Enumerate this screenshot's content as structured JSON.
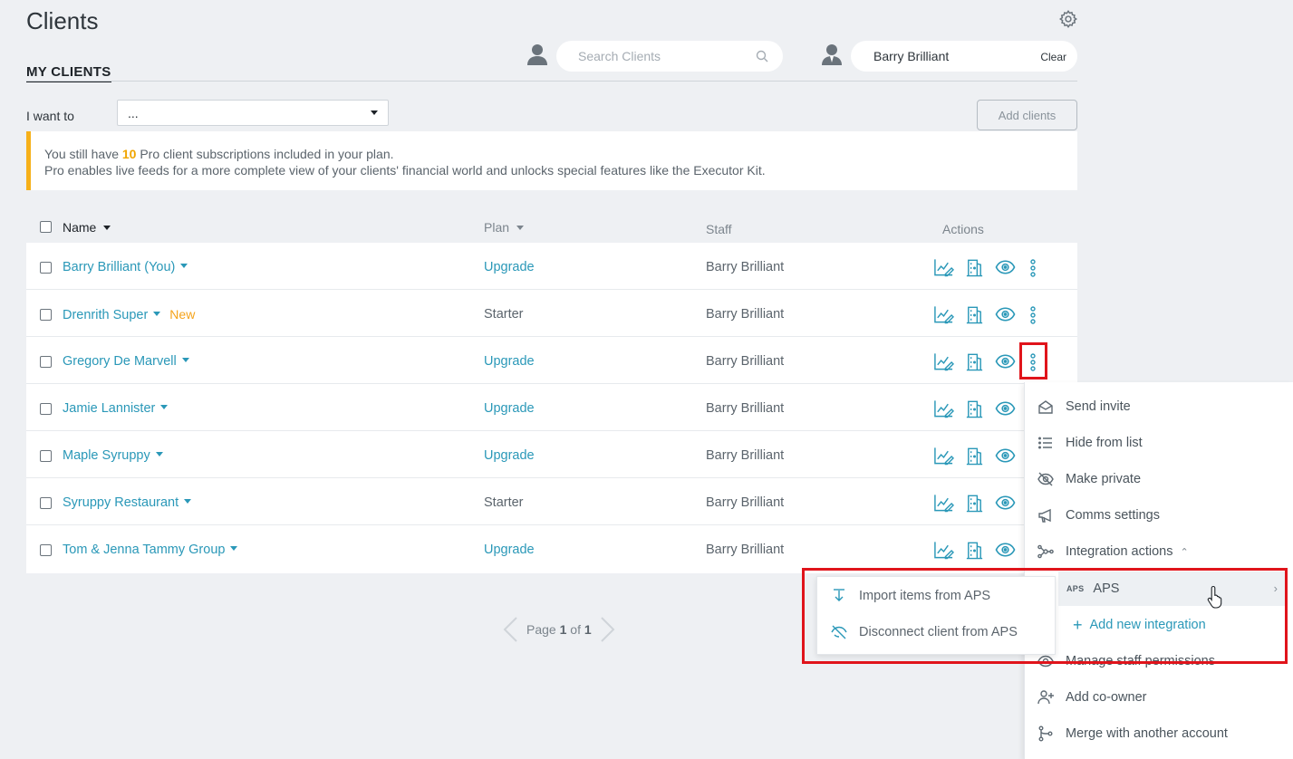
{
  "page": {
    "title": "Clients",
    "tab_label": "MY CLIENTS"
  },
  "search": {
    "placeholder": "Search Clients"
  },
  "staff_filter": {
    "value": "Barry Brilliant",
    "clear_label": "Clear"
  },
  "toolbar": {
    "i_want_to_label": "I want to",
    "i_want_to_value": "...",
    "add_clients_label": "Add clients"
  },
  "notice": {
    "line1_prefix": "You still have ",
    "line1_count": "10",
    "line1_suffix": " Pro client subscriptions included in your plan.",
    "line2": "Pro enables live feeds for a more complete view of your clients' financial world and unlocks special features like the Executor Kit."
  },
  "table": {
    "headers": {
      "name": "Name",
      "plan": "Plan",
      "staff": "Staff",
      "actions": "Actions"
    },
    "rows": [
      {
        "name": "Barry Brilliant (You)",
        "badge": "",
        "plan": "Upgrade",
        "plan_is_link": true,
        "staff": "Barry Brilliant"
      },
      {
        "name": "Drenrith Super",
        "badge": "New",
        "plan": "Starter",
        "plan_is_link": false,
        "staff": "Barry Brilliant"
      },
      {
        "name": "Gregory De Marvell",
        "badge": "",
        "plan": "Upgrade",
        "plan_is_link": true,
        "staff": "Barry Brilliant"
      },
      {
        "name": "Jamie Lannister",
        "badge": "",
        "plan": "Upgrade",
        "plan_is_link": true,
        "staff": "Barry Brilliant"
      },
      {
        "name": "Maple Syruppy",
        "badge": "",
        "plan": "Upgrade",
        "plan_is_link": true,
        "staff": "Barry Brilliant"
      },
      {
        "name": "Syruppy Restaurant",
        "badge": "",
        "plan": "Starter",
        "plan_is_link": false,
        "staff": "Barry Brilliant"
      },
      {
        "name": "Tom & Jenna Tammy Group",
        "badge": "",
        "plan": "Upgrade",
        "plan_is_link": true,
        "staff": "Barry Brilliant"
      }
    ]
  },
  "pagination": {
    "prefix": "Page ",
    "current": "1",
    "middle": " of ",
    "total": "1"
  },
  "context_menu": {
    "items": [
      {
        "label": "Send invite",
        "icon": "envelope-open-icon"
      },
      {
        "label": "Hide from list",
        "icon": "list-icon"
      },
      {
        "label": "Make private",
        "icon": "eye-slash-icon"
      },
      {
        "label": "Comms settings",
        "icon": "megaphone-icon"
      },
      {
        "label": "Integration actions",
        "icon": "integration-nodes-icon"
      },
      {
        "label": "Manage staff permissions",
        "icon": "eye-icon"
      },
      {
        "label": "Add co-owner",
        "icon": "user-plus-icon"
      },
      {
        "label": "Merge with another account",
        "icon": "merge-branch-icon"
      }
    ]
  },
  "integration_submenu": {
    "aps_tag": "APS",
    "aps_label": "APS",
    "add_new_label": "Add new integration"
  },
  "aps_flyout": {
    "items": [
      {
        "label": "Import items from APS",
        "icon": "import-arrow-icon"
      },
      {
        "label": "Disconnect client from APS",
        "icon": "disconnect-icon"
      }
    ]
  },
  "colors": {
    "accent": "#2a98b8",
    "new_badge": "#f5a31a",
    "notice_bar": "#f6b019",
    "highlight": "#e0141b",
    "background": "#eef0f3"
  }
}
